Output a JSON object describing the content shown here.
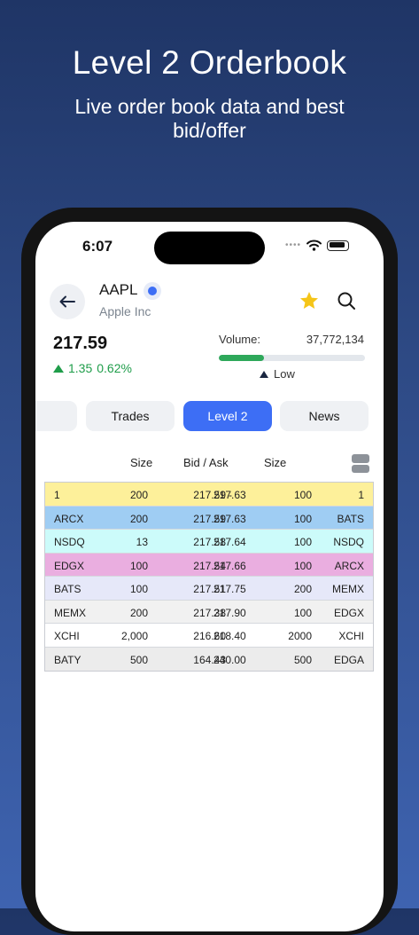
{
  "promo": {
    "title": "Level 2 Orderbook",
    "subtitle": "Live order book data and best bid/offer"
  },
  "status_bar": {
    "time": "6:07"
  },
  "quote": {
    "symbol": "AAPL",
    "company": "Apple Inc",
    "price": "217.59",
    "change": "1.35",
    "change_pct": "0.62%",
    "volume_label": "Volume:",
    "volume_value": "37,772,134",
    "volume_level": "Low",
    "volume_fill_fraction": 0.31,
    "colors": {
      "up": "#1f9d4a",
      "accent": "#3d6ef5",
      "star": "#f5c518"
    }
  },
  "tabs": [
    {
      "label": "",
      "active": false
    },
    {
      "label": "Trades",
      "active": false
    },
    {
      "label": "Level 2",
      "active": true
    },
    {
      "label": "News",
      "active": false
    }
  ],
  "book": {
    "headers": {
      "bid_size": "Size",
      "bid_ask": "Bid / Ask",
      "ask_size": "Size"
    },
    "rows": [
      {
        "bid_exch": "1",
        "bid_size": "200",
        "bid": "217.59",
        "sep": "-",
        "ask": "217.63",
        "ask_size": "100",
        "ask_exch": "1",
        "color": "#fdf09a"
      },
      {
        "bid_exch": "ARCX",
        "bid_size": "200",
        "bid": "217.59",
        "sep": "",
        "ask": "217.63",
        "ask_size": "100",
        "ask_exch": "BATS",
        "color": "#9fcdf3"
      },
      {
        "bid_exch": "NSDQ",
        "bid_size": "13",
        "bid": "217.58",
        "sep": "",
        "ask": "217.64",
        "ask_size": "100",
        "ask_exch": "NSDQ",
        "color": "#ccfbfa"
      },
      {
        "bid_exch": "EDGX",
        "bid_size": "100",
        "bid": "217.54",
        "sep": "",
        "ask": "217.66",
        "ask_size": "100",
        "ask_exch": "ARCX",
        "color": "#eaaee0"
      },
      {
        "bid_exch": "BATS",
        "bid_size": "100",
        "bid": "217.51",
        "sep": "",
        "ask": "217.75",
        "ask_size": "200",
        "ask_exch": "MEMX",
        "color": "#e6e8f9"
      },
      {
        "bid_exch": "MEMX",
        "bid_size": "200",
        "bid": "217.38",
        "sep": "",
        "ask": "217.90",
        "ask_size": "100",
        "ask_exch": "EDGX",
        "color": "#f1f1f1"
      },
      {
        "bid_exch": "XCHI",
        "bid_size": "2,000",
        "bid": "216.60",
        "sep": "",
        "ask": "218.40",
        "ask_size": "2000",
        "ask_exch": "XCHI",
        "color": "#ffffff"
      },
      {
        "bid_exch": "BATY",
        "bid_size": "500",
        "bid": "164.43",
        "sep": "",
        "ask": "240.00",
        "ask_size": "500",
        "ask_exch": "EDGA",
        "color": "#ececec"
      }
    ]
  }
}
